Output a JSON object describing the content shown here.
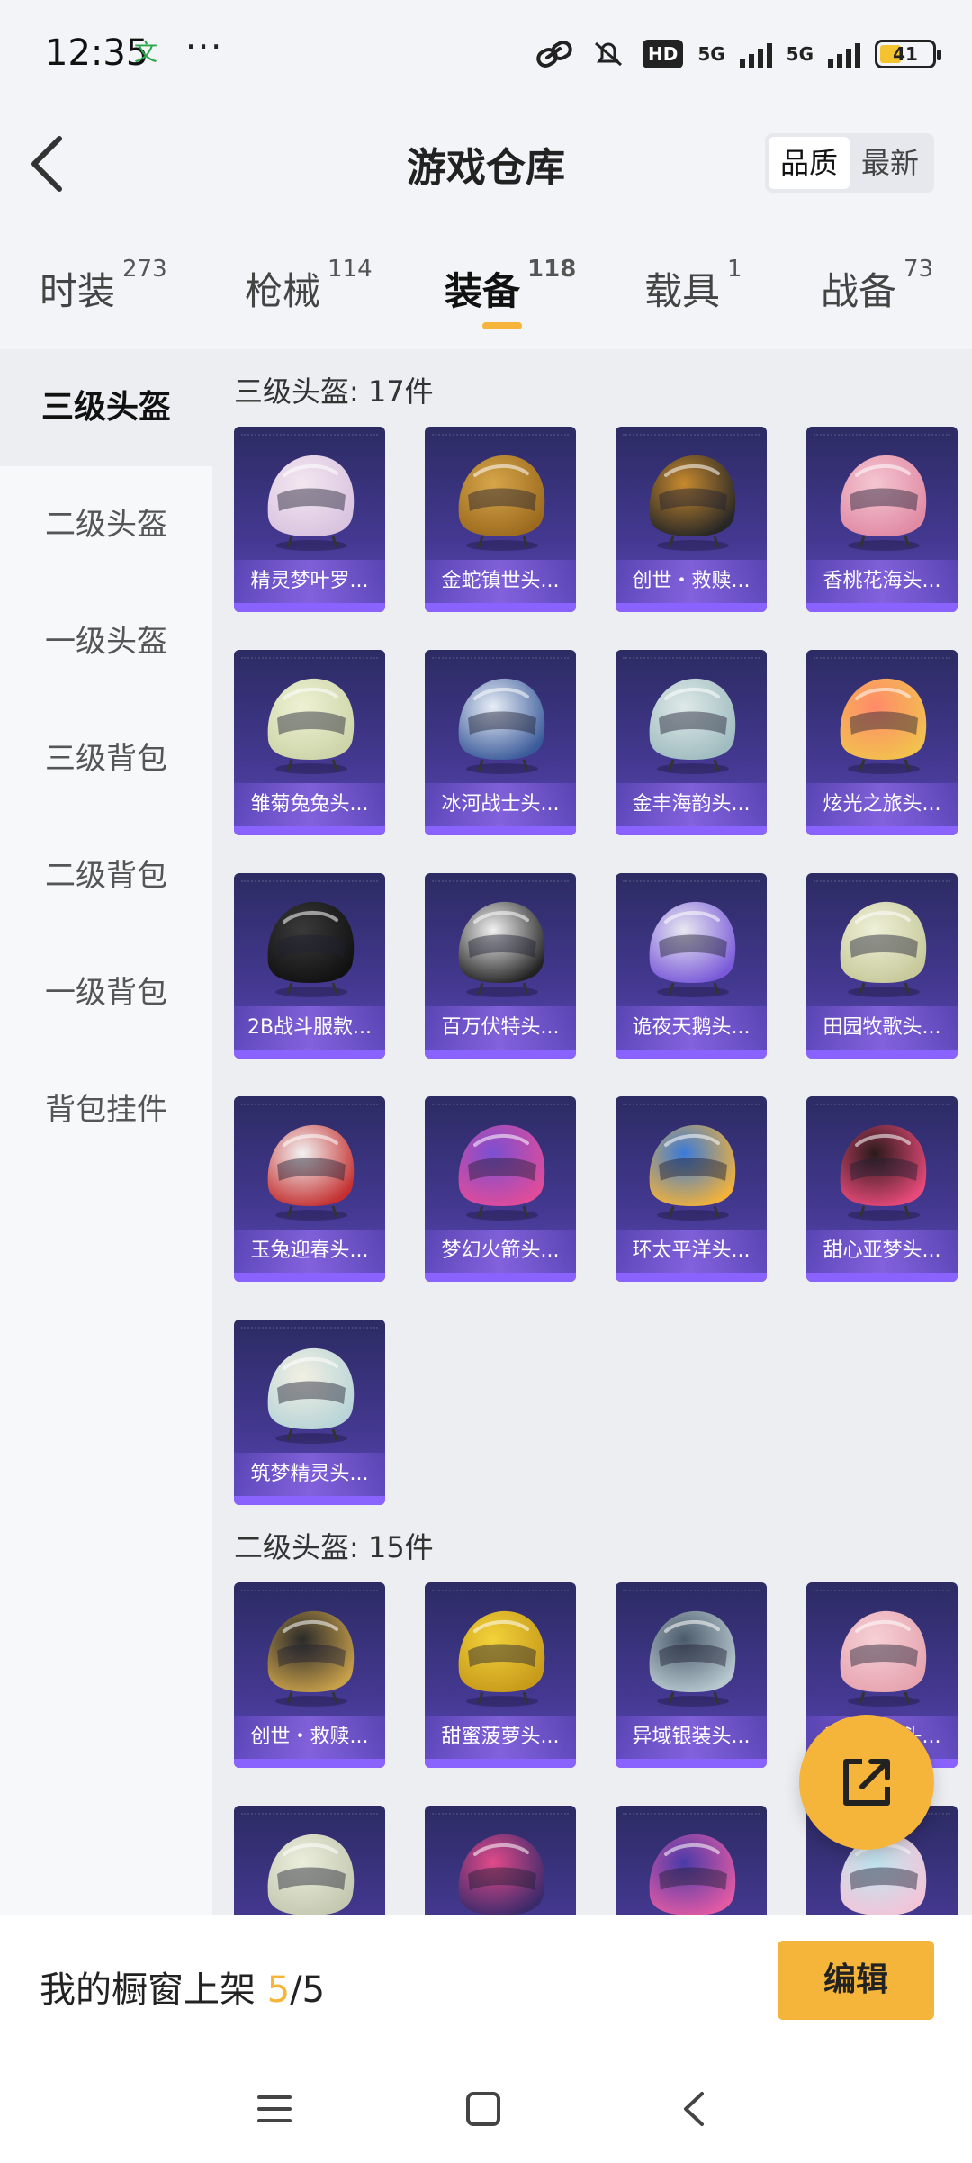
{
  "status_bar": {
    "time": "12:35",
    "app_icon_glyph": "文",
    "more": "···",
    "hd": "HD",
    "net1": "5G",
    "net2": "5G",
    "battery": "41"
  },
  "header": {
    "title": "游戏仓库",
    "sort": [
      "品质",
      "最新"
    ]
  },
  "tabs": [
    {
      "label": "时装",
      "count": "273"
    },
    {
      "label": "枪械",
      "count": "114"
    },
    {
      "label": "装备",
      "count": "118"
    },
    {
      "label": "载具",
      "count": "1"
    },
    {
      "label": "战备",
      "count": "73"
    }
  ],
  "sidebar": [
    "三级头盔",
    "二级头盔",
    "一级头盔",
    "三级背包",
    "二级背包",
    "一级背包",
    "背包挂件"
  ],
  "sections": [
    {
      "title": "三级头盔: 17件",
      "items": [
        "精灵梦叶罗...",
        "金蛇镇世头...",
        "创世・救赎...",
        "香桃花海头...",
        "雏菊兔兔头...",
        "冰河战士头...",
        "金丰海韵头...",
        "炫光之旅头...",
        "2B战斗服款...",
        "百万伏特头...",
        "诡夜天鹅头...",
        "田园牧歌头...",
        "玉兔迎春头...",
        "梦幻火箭头...",
        "环太平洋头...",
        "甜心亚梦头...",
        "筑梦精灵头..."
      ]
    },
    {
      "title": "二级头盔: 15件",
      "items": [
        "创世・救赎...",
        "甜蜜菠萝头...",
        "异域银装头...",
        "香桃花海头...",
        "",
        "",
        "",
        ""
      ]
    }
  ],
  "colors": {
    "accent": "#f4b53a",
    "card_top": "#2c2b63",
    "card_bottom": "#5b48b6"
  },
  "bottom": {
    "text": "我的橱窗上架",
    "current": "5",
    "total": "/5",
    "edit": "编辑"
  },
  "icons": {
    "back": "chevron-left-icon",
    "fab": "share-external-icon",
    "nav": [
      "menu-icon",
      "home-square-icon",
      "back-icon"
    ]
  }
}
